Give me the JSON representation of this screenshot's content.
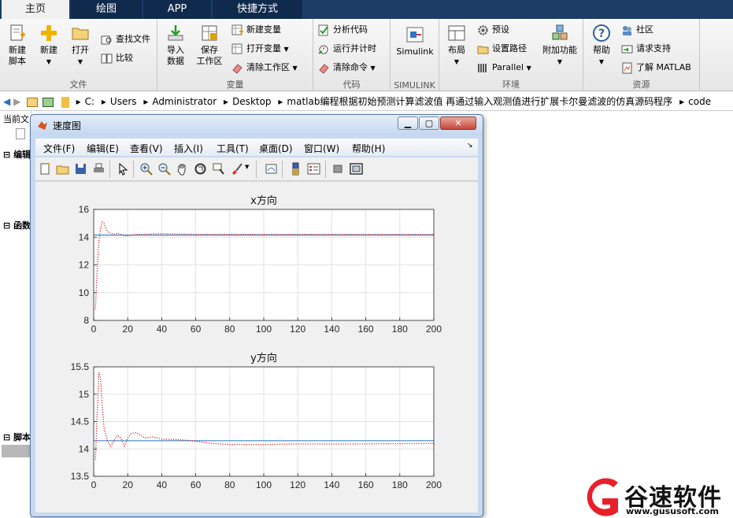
{
  "tabs": [
    {
      "label": "主页",
      "active": true
    },
    {
      "label": "绘图"
    },
    {
      "label": "APP"
    },
    {
      "label": "快捷方式"
    }
  ],
  "ribbon": {
    "file": {
      "label": "文件",
      "new_script": "新建\n脚本",
      "new": "新建",
      "open": "打开",
      "find_files": "查找文件",
      "compare": "比较"
    },
    "variable": {
      "label": "变量",
      "import": "导入\n数据",
      "save_ws": "保存\n工作区",
      "new_var": "新建变量",
      "open_var": "打开变量",
      "clear_ws": "清除工作区"
    },
    "code": {
      "label": "代码",
      "analyze": "分析代码",
      "run_time": "运行并计时",
      "clear_cmd": "清除命令"
    },
    "simulink": {
      "label": "SIMULINK",
      "btn": "Simulink"
    },
    "env": {
      "label": "环境",
      "layout": "布局",
      "prefs": "预设",
      "set_path": "设置路径",
      "parallel": "Parallel",
      "addons": "附加功能"
    },
    "resources": {
      "label": "资源",
      "help": "帮助",
      "community": "社区",
      "support": "请求支持",
      "learn": "了解 MATLAB"
    }
  },
  "address": {
    "segments": [
      "C:",
      "Users",
      "Administrator",
      "Desktop",
      "matlab编程根据初始预测计算滤波值 再通过输入观测值进行扩展卡尔曼滤波的仿真源码程序",
      "code"
    ]
  },
  "left": {
    "current_folder": "当前文",
    "edit": "编辑",
    "func": "函数",
    "script": "脚本"
  },
  "figure": {
    "title": "速度图",
    "menus": [
      "文件(F)",
      "编辑(E)",
      "查看(V)",
      "插入(I)",
      "工具(T)",
      "桌面(D)",
      "窗口(W)",
      "帮助(H)"
    ]
  },
  "chart_data": [
    {
      "type": "line",
      "title": "x方向",
      "xlim": [
        0,
        200
      ],
      "ylim": [
        8,
        16
      ],
      "xticks": [
        0,
        20,
        40,
        60,
        80,
        100,
        120,
        140,
        160,
        180,
        200
      ],
      "yticks": [
        8,
        10,
        12,
        14,
        16
      ],
      "grid": true,
      "series": [
        {
          "color": "#3a86c8",
          "style": "solid",
          "x": [
            0,
            200
          ],
          "y": [
            14.15,
            14.15
          ]
        },
        {
          "color": "#e02020",
          "style": "dotted",
          "x": [
            1,
            2,
            3,
            4,
            5,
            6,
            7,
            8,
            9,
            10,
            12,
            14,
            16,
            18,
            20,
            25,
            30,
            40,
            60,
            80,
            100,
            140,
            200
          ],
          "y": [
            8.8,
            11.5,
            13.6,
            14.6,
            15.1,
            15.0,
            14.7,
            14.4,
            14.3,
            14.3,
            14.2,
            14.3,
            14.2,
            14.1,
            14.1,
            14.2,
            14.2,
            14.25,
            14.2,
            14.2,
            14.2,
            14.2,
            14.2
          ]
        }
      ]
    },
    {
      "type": "line",
      "title": "y方向",
      "xlim": [
        0,
        200
      ],
      "ylim": [
        13.5,
        15.5
      ],
      "xticks": [
        0,
        20,
        40,
        60,
        80,
        100,
        120,
        140,
        160,
        180,
        200
      ],
      "yticks": [
        13.5,
        14,
        14.5,
        15,
        15.5
      ],
      "grid": true,
      "series": [
        {
          "color": "#3a86c8",
          "style": "solid",
          "x": [
            0,
            200
          ],
          "y": [
            14.15,
            14.15
          ]
        },
        {
          "color": "#e02020",
          "style": "dotted",
          "x": [
            1,
            2,
            3,
            4,
            5,
            6,
            8,
            10,
            12,
            14,
            16,
            18,
            20,
            22,
            25,
            30,
            35,
            40,
            50,
            60,
            70,
            80,
            100,
            120,
            150,
            200
          ],
          "y": [
            13.8,
            14.6,
            15.4,
            15.3,
            14.8,
            14.4,
            14.15,
            14.05,
            14.15,
            14.25,
            14.2,
            14.05,
            14.2,
            14.28,
            14.3,
            14.2,
            14.22,
            14.18,
            14.17,
            14.14,
            14.1,
            14.08,
            14.08,
            14.09,
            14.09,
            14.1
          ]
        }
      ]
    }
  ],
  "watermark": {
    "text": "谷速软件",
    "url": "www.gususoft.com",
    "colors": {
      "red": "#e8202a"
    }
  }
}
